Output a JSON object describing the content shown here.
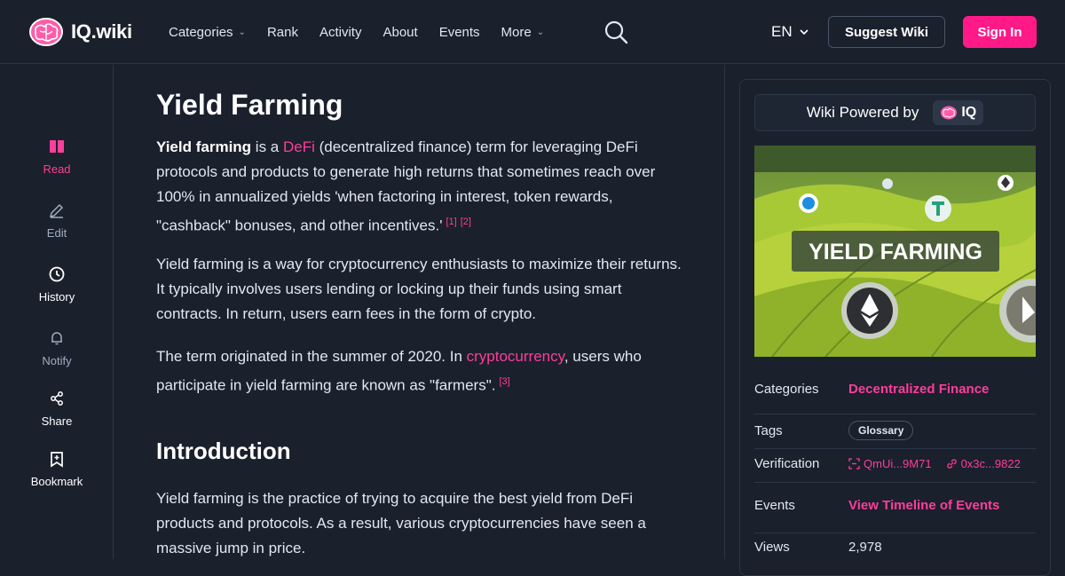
{
  "brand": {
    "name": "IQ.wiki",
    "accent": "#ff1a88"
  },
  "nav": {
    "items": [
      {
        "label": "Categories",
        "dropdown": true
      },
      {
        "label": "Rank",
        "dropdown": false
      },
      {
        "label": "Activity",
        "dropdown": false
      },
      {
        "label": "About",
        "dropdown": false
      },
      {
        "label": "Events",
        "dropdown": false
      },
      {
        "label": "More",
        "dropdown": true
      }
    ],
    "language": "EN",
    "suggest_label": "Suggest Wiki",
    "signin_label": "Sign In"
  },
  "sidebar": {
    "items": [
      {
        "label": "Read",
        "icon": "book-icon",
        "state": "active"
      },
      {
        "label": "Edit",
        "icon": "pencil-icon",
        "state": "muted"
      },
      {
        "label": "History",
        "icon": "history-icon",
        "state": "normal"
      },
      {
        "label": "Notify",
        "icon": "bell-icon",
        "state": "muted"
      },
      {
        "label": "Share",
        "icon": "share-icon",
        "state": "normal"
      },
      {
        "label": "Bookmark",
        "icon": "bookmark-icon",
        "state": "normal"
      }
    ]
  },
  "article": {
    "title": "Yield Farming",
    "p1": {
      "bold": "Yield farming",
      "t1": " is a ",
      "link1": "DeFi",
      "t2": " (decentralized finance) term for leveraging DeFi protocols and products to generate high returns that sometimes reach over 100% in annualized yields 'when factoring in interest, token rewards, \"cashback\" bonuses, and other incentives.'",
      "ref1": "[1]",
      "ref2": "[2]"
    },
    "p2": "Yield farming is a way for cryptocurrency enthusiasts to maximize their returns. It typically involves users lending or locking up their funds using smart contracts. In return, users earn fees in the form of crypto.",
    "p3": {
      "t1": "The term originated in the summer of 2020. In ",
      "link": "cryptocurrency",
      "t2": ", users who participate in yield farming are known as \"farmers\".",
      "ref": "[3]"
    },
    "intro_heading": "Introduction",
    "p4": "Yield farming is the practice of trying to acquire the best yield from DeFi products and protocols. As a result, various cryptocurrencies have seen a massive jump in price."
  },
  "panel": {
    "powered_label": "Wiki Powered by",
    "powered_brand": "IQ",
    "hero_text": "YIELD FARMING",
    "categories_label": "Categories",
    "categories_value": "Decentralized Finance",
    "tags_label": "Tags",
    "tag": "Glossary",
    "verification_label": "Verification",
    "ipfs_hash": "QmUi...9M71",
    "tx_hash": "0x3c...9822",
    "events_label": "Events",
    "events_value": "View Timeline of Events",
    "views_label": "Views",
    "views_value": "2,978"
  }
}
